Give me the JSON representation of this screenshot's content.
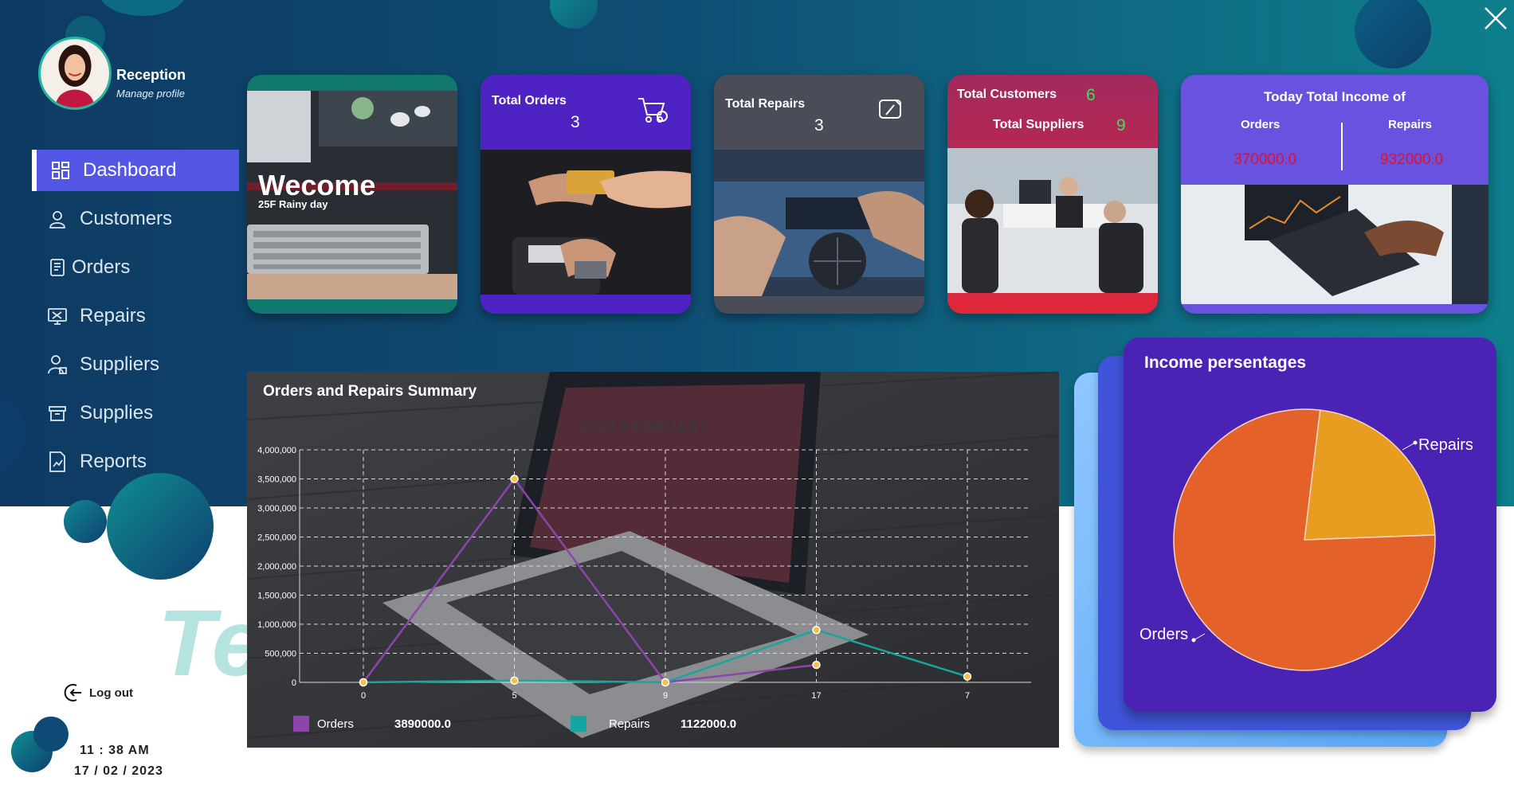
{
  "profile": {
    "name": "Reception",
    "subtitle": "Manage profile"
  },
  "sidebar": {
    "items": [
      {
        "label": "Dashboard",
        "icon": "dashboard-grid-icon",
        "active": true
      },
      {
        "label": "Customers",
        "icon": "user-icon"
      },
      {
        "label": "Orders",
        "icon": "document-icon"
      },
      {
        "label": "Repairs",
        "icon": "repair-monitor-icon"
      },
      {
        "label": "Suppliers",
        "icon": "supplier-person-icon"
      },
      {
        "label": "Supplies",
        "icon": "box-icon"
      },
      {
        "label": "Reports",
        "icon": "report-chart-icon"
      }
    ],
    "logout_label": "Log out",
    "watermark": "Te"
  },
  "clock": {
    "time": "11 : 38   AM",
    "date": "17 / 02 / 2023"
  },
  "cards": {
    "welcome": {
      "title": "Wecome",
      "subtitle": "25F Rainy day"
    },
    "orders": {
      "title": "Total Orders",
      "value": "3"
    },
    "repairs": {
      "title": "Total Repairs",
      "value": "3"
    },
    "customers": {
      "title": "Total Customers",
      "value": "6",
      "suppliers_title": "Total Suppliers",
      "suppliers_value": "9"
    },
    "income": {
      "title": "Today Total Income of",
      "orders_label": "Orders",
      "repairs_label": "Repairs",
      "orders_value": "370000.0",
      "repairs_value": "932000.0"
    }
  },
  "colors": {
    "accent": "#5457e6",
    "orders_series": "#8e44ad",
    "repairs_series": "#17a5a0",
    "income_value": "#e0102a",
    "count_green": "#3de05a"
  },
  "chart_data": {
    "type": "line",
    "title": "Orders and Repairs Summary",
    "subtitle": "2023 FEBRUARY",
    "categories": [
      "0",
      "5",
      "9",
      "17",
      "7"
    ],
    "y_ticks": [
      "0",
      "500,000",
      "1,000,000",
      "1,500,000",
      "2,000,000",
      "2,500,000",
      "3,000,000",
      "3,500,000",
      "4,000,000"
    ],
    "ylim": [
      0,
      4000000
    ],
    "grid": true,
    "series": [
      {
        "name": "Orders",
        "color": "#8e44ad",
        "values": [
          0,
          3500000,
          0,
          300000,
          null
        ],
        "total": "3890000.0"
      },
      {
        "name": "Repairs",
        "color": "#17a5a0",
        "values": [
          0,
          30000,
          0,
          900000,
          100000
        ],
        "total": "1122000.0"
      }
    ]
  },
  "pie_data": {
    "type": "pie",
    "title": "Income persentages",
    "slices": [
      {
        "label": "Orders",
        "value": 77.5,
        "color": "#e4622a"
      },
      {
        "label": "Repairs",
        "value": 22.5,
        "color": "#e89c20"
      }
    ]
  }
}
